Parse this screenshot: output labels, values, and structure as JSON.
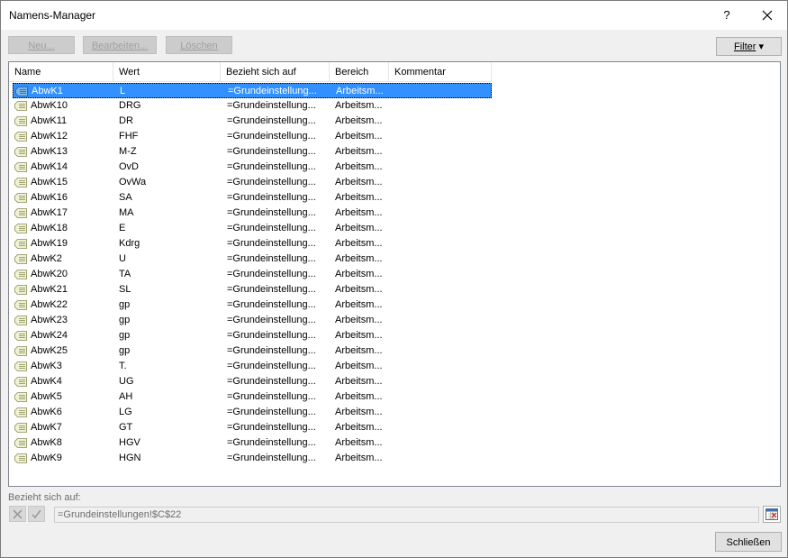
{
  "window": {
    "title": "Namens-Manager",
    "help": "?"
  },
  "toolbar": {
    "new_label": "Neu...",
    "edit_label": "Bearbeiten...",
    "delete_label": "Löschen",
    "filter_label": "Filter",
    "filter_arrow": "▾"
  },
  "columns": [
    "Name",
    "Wert",
    "Bezieht sich auf",
    "Bereich",
    "Kommentar"
  ],
  "rows": [
    {
      "name": "AbwK1",
      "value": "L",
      "ref": "=Grundeinstellung...",
      "scope": "Arbeitsm...",
      "comment": "",
      "selected": true
    },
    {
      "name": "AbwK10",
      "value": "DRG",
      "ref": "=Grundeinstellung...",
      "scope": "Arbeitsm...",
      "comment": ""
    },
    {
      "name": "AbwK11",
      "value": "DR",
      "ref": "=Grundeinstellung...",
      "scope": "Arbeitsm...",
      "comment": ""
    },
    {
      "name": "AbwK12",
      "value": "FHF",
      "ref": "=Grundeinstellung...",
      "scope": "Arbeitsm...",
      "comment": ""
    },
    {
      "name": "AbwK13",
      "value": "M-Z",
      "ref": "=Grundeinstellung...",
      "scope": "Arbeitsm...",
      "comment": ""
    },
    {
      "name": "AbwK14",
      "value": "OvD",
      "ref": "=Grundeinstellung...",
      "scope": "Arbeitsm...",
      "comment": ""
    },
    {
      "name": "AbwK15",
      "value": "OvWa",
      "ref": "=Grundeinstellung...",
      "scope": "Arbeitsm...",
      "comment": ""
    },
    {
      "name": "AbwK16",
      "value": "SA",
      "ref": "=Grundeinstellung...",
      "scope": "Arbeitsm...",
      "comment": ""
    },
    {
      "name": "AbwK17",
      "value": "MA",
      "ref": "=Grundeinstellung...",
      "scope": "Arbeitsm...",
      "comment": ""
    },
    {
      "name": "AbwK18",
      "value": "E",
      "ref": "=Grundeinstellung...",
      "scope": "Arbeitsm...",
      "comment": ""
    },
    {
      "name": "AbwK19",
      "value": "Kdrg",
      "ref": "=Grundeinstellung...",
      "scope": "Arbeitsm...",
      "comment": ""
    },
    {
      "name": "AbwK2",
      "value": "U",
      "ref": "=Grundeinstellung...",
      "scope": "Arbeitsm...",
      "comment": ""
    },
    {
      "name": "AbwK20",
      "value": "TA",
      "ref": "=Grundeinstellung...",
      "scope": "Arbeitsm...",
      "comment": ""
    },
    {
      "name": "AbwK21",
      "value": "SL",
      "ref": "=Grundeinstellung...",
      "scope": "Arbeitsm...",
      "comment": ""
    },
    {
      "name": "AbwK22",
      "value": "gp",
      "ref": "=Grundeinstellung...",
      "scope": "Arbeitsm...",
      "comment": ""
    },
    {
      "name": "AbwK23",
      "value": "gp",
      "ref": "=Grundeinstellung...",
      "scope": "Arbeitsm...",
      "comment": ""
    },
    {
      "name": "AbwK24",
      "value": "gp",
      "ref": "=Grundeinstellung...",
      "scope": "Arbeitsm...",
      "comment": ""
    },
    {
      "name": "AbwK25",
      "value": "gp",
      "ref": "=Grundeinstellung...",
      "scope": "Arbeitsm...",
      "comment": ""
    },
    {
      "name": "AbwK3",
      "value": "T.",
      "ref": "=Grundeinstellung...",
      "scope": "Arbeitsm...",
      "comment": ""
    },
    {
      "name": "AbwK4",
      "value": "UG",
      "ref": "=Grundeinstellung...",
      "scope": "Arbeitsm...",
      "comment": ""
    },
    {
      "name": "AbwK5",
      "value": "AH",
      "ref": "=Grundeinstellung...",
      "scope": "Arbeitsm...",
      "comment": ""
    },
    {
      "name": "AbwK6",
      "value": "LG",
      "ref": "=Grundeinstellung...",
      "scope": "Arbeitsm...",
      "comment": ""
    },
    {
      "name": "AbwK7",
      "value": "GT",
      "ref": "=Grundeinstellung...",
      "scope": "Arbeitsm...",
      "comment": ""
    },
    {
      "name": "AbwK8",
      "value": "HGV",
      "ref": "=Grundeinstellung...",
      "scope": "Arbeitsm...",
      "comment": ""
    },
    {
      "name": "AbwK9",
      "value": "HGN",
      "ref": "=Grundeinstellung...",
      "scope": "Arbeitsm...",
      "comment": ""
    }
  ],
  "reference": {
    "label": "Bezieht sich auf:",
    "value": "=Grundeinstellungen!$C$22"
  },
  "footer": {
    "close_label": "Schließen"
  },
  "colors": {
    "selection": "#3390ff",
    "window_bg": "#f0f0f0"
  },
  "icons": {
    "name_icon": "named-range-icon",
    "cancel": "cross-icon",
    "confirm": "check-icon",
    "picker": "range-picker-icon"
  }
}
